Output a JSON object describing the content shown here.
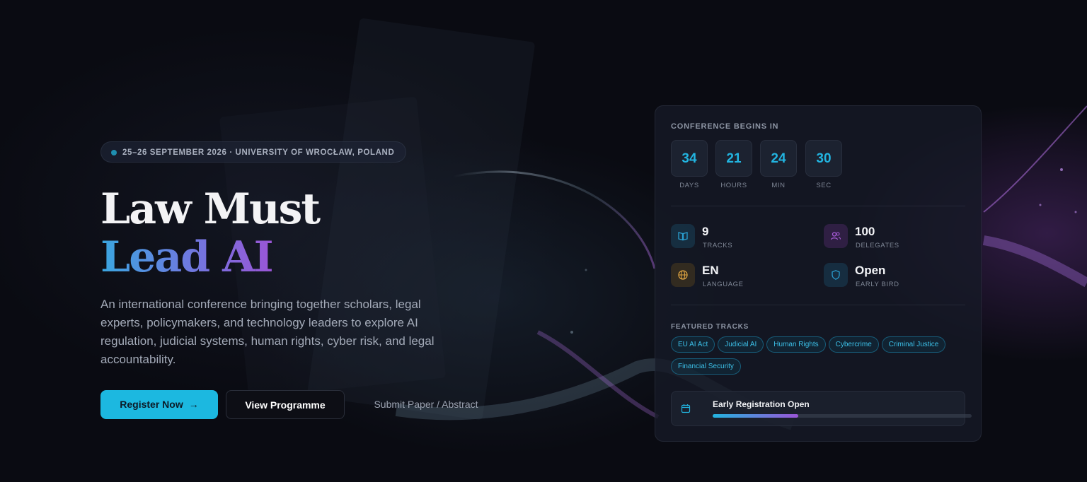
{
  "hero": {
    "badge": "25–26 SEPTEMBER 2026 · UNIVERSITY OF WROCŁAW, POLAND",
    "title_line1": "Law Must",
    "title_line2": "Lead AI",
    "description": "An international conference bringing together scholars, legal experts, policymakers, and technology leaders to explore AI regulation, judicial systems, human rights, cyber risk, and legal accountability.",
    "primary_button": "Register Now",
    "secondary_button": "View Programme",
    "tertiary_link": "Submit Paper / Abstract"
  },
  "countdown": {
    "heading": "CONFERENCE BEGINS IN",
    "units": [
      {
        "value": "34",
        "label": "DAYS"
      },
      {
        "value": "21",
        "label": "HOURS"
      },
      {
        "value": "24",
        "label": "MIN"
      },
      {
        "value": "30",
        "label": "SEC"
      }
    ]
  },
  "stats": [
    {
      "value": "9",
      "label": "TRACKS",
      "icon": "book-icon",
      "color": "#2a9fd0"
    },
    {
      "value": "100",
      "label": "DELEGATES",
      "icon": "users-icon",
      "color": "#a85bd8"
    },
    {
      "value": "EN",
      "label": "LANGUAGE",
      "icon": "globe-icon",
      "color": "#d9a040"
    },
    {
      "value": "Open",
      "label": "EARLY BIRD",
      "icon": "shield-icon",
      "color": "#2a9fd0"
    }
  ],
  "featured_tracks": {
    "heading": "FEATURED TRACKS",
    "items": [
      "EU AI Act",
      "Judicial AI",
      "Human Rights",
      "Cybercrime",
      "Criminal Justice",
      "Financial Security"
    ]
  },
  "registration": {
    "label": "Early Registration Open",
    "progress": 0.33
  },
  "colors": {
    "accent": "#1cb8e0",
    "gradient_end": "#9a55d6",
    "background": "#0a0b12"
  }
}
